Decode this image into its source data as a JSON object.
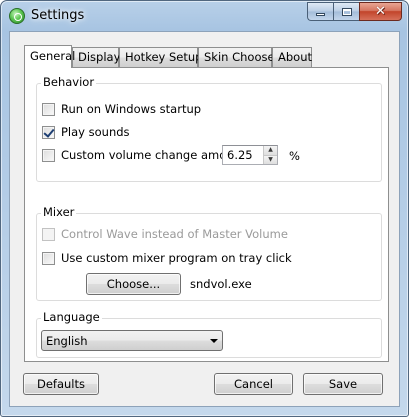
{
  "window": {
    "title": "Settings"
  },
  "tabs": [
    {
      "label": "General",
      "active": true
    },
    {
      "label": "Display",
      "active": false
    },
    {
      "label": "Hotkey Setup",
      "active": false
    },
    {
      "label": "Skin Chooser",
      "active": false
    },
    {
      "label": "About",
      "active": false
    }
  ],
  "behavior": {
    "label": "Behavior",
    "run_on_startup": {
      "label": "Run on Windows startup",
      "checked": false
    },
    "play_sounds": {
      "label": "Play sounds",
      "checked": true
    },
    "custom_volume": {
      "label": "Custom volume change amount:",
      "checked": false,
      "value": "6.25",
      "unit": "%"
    }
  },
  "mixer": {
    "label": "Mixer",
    "control_wave": {
      "label": "Control Wave instead of Master Volume",
      "checked": false,
      "disabled": true
    },
    "custom_mixer": {
      "label": "Use custom mixer program on tray click",
      "checked": false
    },
    "choose_label": "Choose...",
    "program_name": "sndvol.exe"
  },
  "language": {
    "label": "Language",
    "selected": "English"
  },
  "footer": {
    "defaults_label": "Defaults",
    "cancel_label": "Cancel",
    "save_label": "Save"
  }
}
